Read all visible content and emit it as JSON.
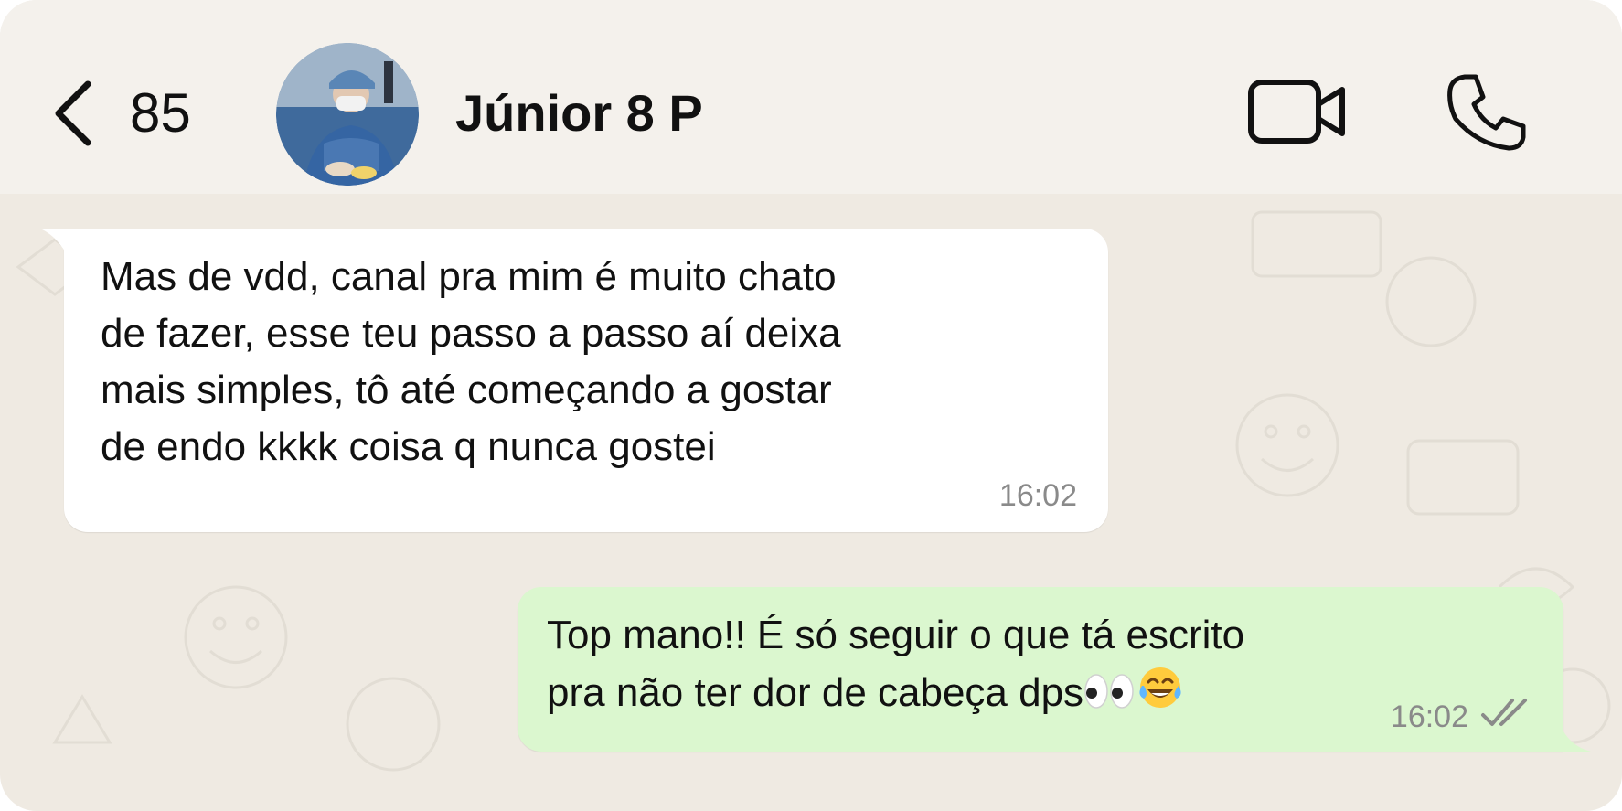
{
  "header": {
    "back_count": "85",
    "contact_name": "Júnior 8 P",
    "icons": [
      "chevron-left-icon",
      "video-camera-icon",
      "phone-icon"
    ]
  },
  "messages": [
    {
      "direction": "incoming",
      "text": "Mas de vdd, canal pra mim é muito chato\nde fazer, esse teu passo a passo aí deixa\nmais simples, tô até começando a gostar\nde endo kkkk coisa q nunca gostei",
      "time": "16:02"
    },
    {
      "direction": "outgoing",
      "line1": "Top mano!! É só seguir o que tá escrito",
      "line2": "pra não ter dor de cabeça dps",
      "emojis": [
        "eyes-emoji",
        "face-with-tears-of-joy-emoji"
      ],
      "time": "16:02",
      "status": "read-double-check"
    }
  ],
  "colors": {
    "chat_background": "#efeae2",
    "header_background": "#f4f1ec",
    "incoming_bubble": "#ffffff",
    "outgoing_bubble": "#dbf7cf",
    "timestamp": "#8a8a8a"
  }
}
